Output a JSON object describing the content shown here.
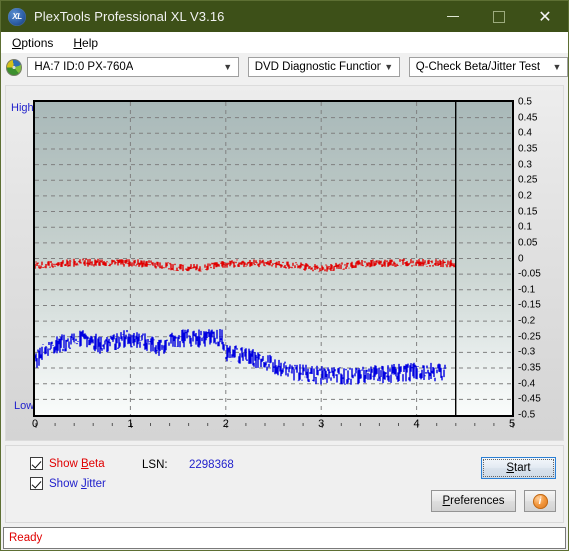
{
  "window": {
    "title": "PlexTools Professional XL V3.16",
    "icon": "xl-logo-icon",
    "minimize": "minimize-icon",
    "maximize": "maximize-icon",
    "close": "close-icon"
  },
  "menubar": {
    "items": [
      {
        "label": "Options",
        "mnemonic": "O"
      },
      {
        "label": "Help",
        "mnemonic": "H"
      }
    ]
  },
  "toolbar": {
    "disc_icon": "disc-icon",
    "drive_select": {
      "value": "HA:7 ID:0  PX-760A",
      "options": [
        "HA:7 ID:0  PX-760A"
      ]
    },
    "function_select": {
      "value": "DVD Diagnostic Functions",
      "options": [
        "DVD Diagnostic Functions"
      ]
    },
    "test_select": {
      "value": "Q-Check Beta/Jitter Test",
      "options": [
        "Q-Check Beta/Jitter Test"
      ]
    }
  },
  "chart_labels": {
    "high": "High",
    "low": "Low"
  },
  "controls": {
    "show_beta": {
      "label": "Show Beta",
      "mnemonic": "B",
      "checked": true,
      "color": "#e00000"
    },
    "show_jitter": {
      "label": "Show Jitter",
      "mnemonic": "J",
      "checked": true,
      "color": "#2222cc"
    },
    "lsn_label": "LSN:",
    "lsn_value": "2298368",
    "start_button": "Start",
    "start_mnemonic": "S",
    "preferences_button": "Preferences",
    "preferences_mnemonic": "P",
    "info_button": "i"
  },
  "status": {
    "text": "Ready"
  },
  "chart_data": {
    "type": "line",
    "title": "Q-Check Beta/Jitter Test",
    "xlabel": "",
    "ylabel": "",
    "xlim": [
      0,
      5
    ],
    "ylim": [
      -0.5,
      0.5
    ],
    "xticks": [
      0,
      1,
      2,
      3,
      4,
      5
    ],
    "yticks": [
      0.5,
      0.45,
      0.4,
      0.35,
      0.3,
      0.25,
      0.2,
      0.15,
      0.1,
      0.05,
      0,
      -0.05,
      -0.1,
      -0.15,
      -0.2,
      -0.25,
      -0.3,
      -0.35,
      -0.4,
      -0.45,
      -0.5
    ],
    "ytick_labels": [
      "0.5",
      "0.45",
      "0.4",
      "0.35",
      "0.3",
      "0.25",
      "0.2",
      "0.15",
      "0.1",
      "0.05",
      "0",
      "-0.05",
      "-0.1",
      "-0.15",
      "-0.2",
      "-0.25",
      "-0.3",
      "-0.35",
      "-0.4",
      "-0.45",
      "-0.5"
    ],
    "xtick_labels": [
      "0",
      "1",
      "2",
      "3",
      "4",
      "5"
    ],
    "x_minor_tick_step": 0.2,
    "grid": true,
    "grid_style": "dashed",
    "grid_color": "#808080",
    "background_gradient": [
      "#a9b9b9",
      "#fafcfb"
    ],
    "legend_position": "below-plot",
    "cursor_line_x": 4.41,
    "data_end_x": 4.41,
    "series": [
      {
        "name": "Beta",
        "color": "#e00000",
        "noise": 0.013,
        "x": [
          0.0,
          0.1,
          0.2,
          0.3,
          0.4,
          0.5,
          0.6,
          0.7,
          0.8,
          0.9,
          1.0,
          1.1,
          1.2,
          1.3,
          1.4,
          1.5,
          1.6,
          1.7,
          1.8,
          1.9,
          2.0,
          2.1,
          2.2,
          2.3,
          2.4,
          2.5,
          2.6,
          2.7,
          2.8,
          2.9,
          3.0,
          3.1,
          3.2,
          3.3,
          3.4,
          3.5,
          3.6,
          3.7,
          3.8,
          3.9,
          4.0,
          4.1,
          4.2,
          4.3,
          4.41
        ],
        "values": [
          -0.021,
          -0.022,
          -0.019,
          -0.016,
          -0.014,
          -0.013,
          -0.013,
          -0.013,
          -0.014,
          -0.014,
          -0.015,
          -0.016,
          -0.018,
          -0.021,
          -0.025,
          -0.029,
          -0.031,
          -0.03,
          -0.026,
          -0.022,
          -0.018,
          -0.016,
          -0.015,
          -0.015,
          -0.016,
          -0.017,
          -0.019,
          -0.022,
          -0.026,
          -0.03,
          -0.031,
          -0.029,
          -0.025,
          -0.021,
          -0.018,
          -0.016,
          -0.015,
          -0.014,
          -0.014,
          -0.013,
          -0.013,
          -0.014,
          -0.015,
          -0.016,
          -0.018
        ]
      },
      {
        "name": "Jitter",
        "color": "#0000e0",
        "noise": 0.03,
        "x": [
          0.0,
          0.1,
          0.2,
          0.3,
          0.4,
          0.5,
          0.6,
          0.7,
          0.8,
          0.9,
          1.0,
          1.1,
          1.2,
          1.3,
          1.4,
          1.5,
          1.6,
          1.7,
          1.8,
          1.9,
          1.96,
          2.0,
          2.1,
          2.2,
          2.3,
          2.4,
          2.5,
          2.6,
          2.7,
          2.8,
          2.9,
          3.0,
          3.1,
          3.2,
          3.3,
          3.4,
          3.5,
          3.6,
          3.7,
          3.8,
          3.9,
          4.0,
          4.1,
          4.2,
          4.3,
          4.41
        ],
        "values": [
          -0.325,
          -0.3,
          -0.28,
          -0.268,
          -0.262,
          -0.258,
          -0.262,
          -0.278,
          -0.268,
          -0.258,
          -0.256,
          -0.262,
          -0.272,
          -0.29,
          -0.268,
          -0.256,
          -0.252,
          -0.254,
          -0.256,
          -0.254,
          -0.252,
          -0.3,
          -0.306,
          -0.312,
          -0.32,
          -0.33,
          -0.342,
          -0.352,
          -0.36,
          -0.366,
          -0.37,
          -0.374,
          -0.376,
          -0.376,
          -0.375,
          -0.374,
          -0.372,
          -0.37,
          -0.368,
          -0.366,
          -0.364,
          -0.362,
          -0.362,
          -0.364,
          -0.368
        ]
      }
    ]
  }
}
